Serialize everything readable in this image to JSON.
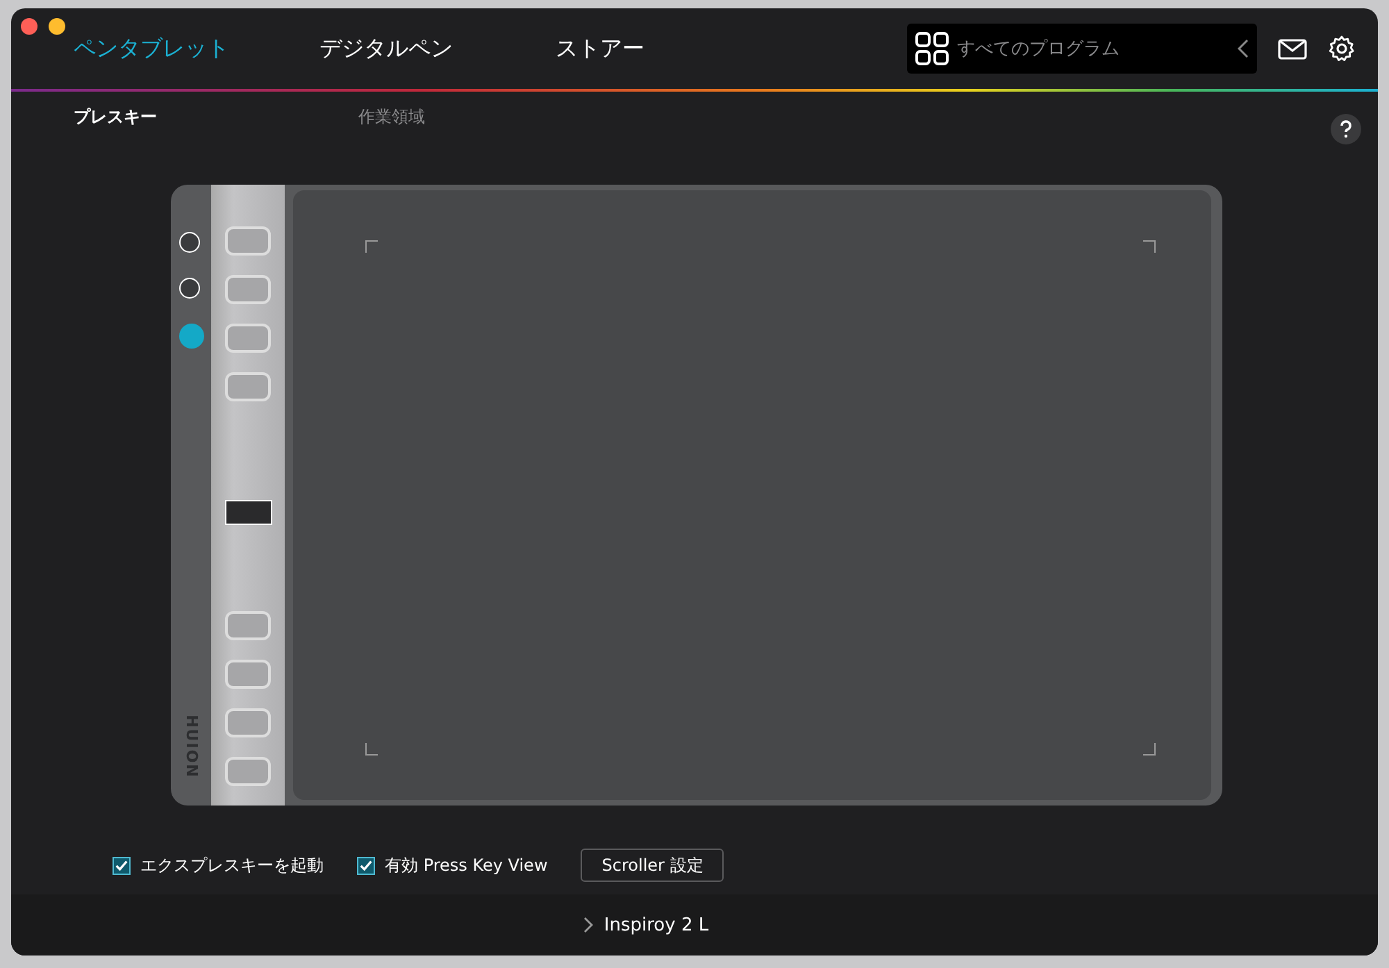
{
  "window": {
    "traffic_lights": [
      {
        "color": "#fe5f57"
      },
      {
        "color": "#febc2e"
      }
    ]
  },
  "tabs": [
    {
      "label": "ペンタブレット",
      "selected": true
    },
    {
      "label": "デジタルペン",
      "selected": false
    },
    {
      "label": "ストアー",
      "selected": false
    }
  ],
  "program_selector": {
    "label": "すべてのプログラム"
  },
  "subtabs": [
    {
      "label": "プレスキー",
      "selected": true
    },
    {
      "label": "作業領域",
      "selected": false
    }
  ],
  "tablet": {
    "brand": "HUION",
    "dials": [
      {
        "selected": false
      },
      {
        "selected": false
      },
      {
        "selected": true
      }
    ]
  },
  "options": [
    {
      "label": "エクスプレスキーを起動",
      "checked": true
    },
    {
      "label": "有効 Press Key View",
      "checked": true
    }
  ],
  "scroller_button": "Scroller 設定",
  "device": {
    "name": "Inspiroy 2 L"
  }
}
